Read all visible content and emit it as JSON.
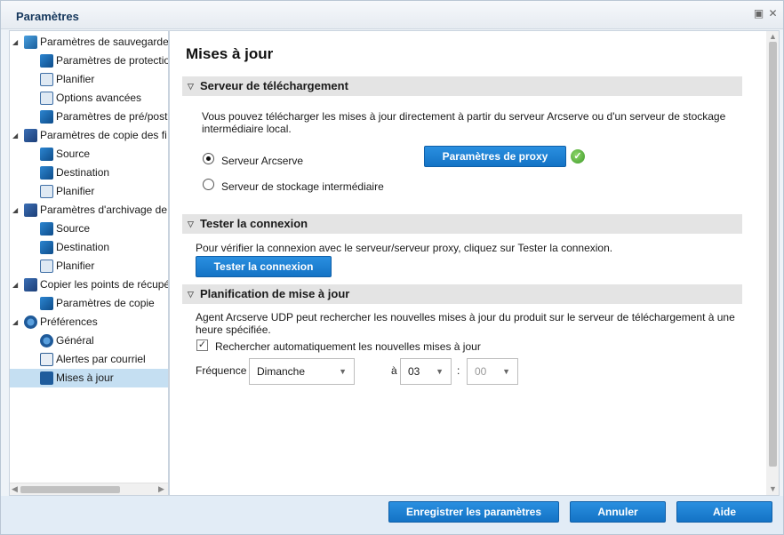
{
  "window": {
    "title": "Paramètres",
    "restore_glyph": "▣",
    "close_glyph": "✕"
  },
  "tree": [
    {
      "label": "Paramètres de sauvegarde",
      "level": 0,
      "icon": "save"
    },
    {
      "label": "Paramètres de protection",
      "level": 1,
      "icon": "leaf-a"
    },
    {
      "label": "Planifier",
      "level": 1,
      "icon": "leaf-b"
    },
    {
      "label": "Options avancées",
      "level": 1,
      "icon": "leaf-b"
    },
    {
      "label": "Paramètres de pré/post",
      "level": 1,
      "icon": "leaf-a"
    },
    {
      "label": "Paramètres de copie des fi",
      "level": 0,
      "icon": "copy"
    },
    {
      "label": "Source",
      "level": 1,
      "icon": "leaf-a"
    },
    {
      "label": "Destination",
      "level": 1,
      "icon": "leaf-a"
    },
    {
      "label": "Planifier",
      "level": 1,
      "icon": "leaf-b"
    },
    {
      "label": "Paramètres d'archivage de",
      "level": 0,
      "icon": "copy"
    },
    {
      "label": "Source",
      "level": 1,
      "icon": "leaf-a"
    },
    {
      "label": "Destination",
      "level": 1,
      "icon": "leaf-a"
    },
    {
      "label": "Planifier",
      "level": 1,
      "icon": "leaf-b"
    },
    {
      "label": "Copier les points de récupé",
      "level": 0,
      "icon": "copy"
    },
    {
      "label": "Paramètres de copie",
      "level": 1,
      "icon": "leaf-a"
    },
    {
      "label": "Préférences",
      "level": 0,
      "icon": "gear"
    },
    {
      "label": "Général",
      "level": 1,
      "icon": "gear"
    },
    {
      "label": "Alertes par courriel",
      "level": 1,
      "icon": "mail"
    },
    {
      "label": "Mises à jour",
      "level": 1,
      "icon": "upd",
      "selected": true
    }
  ],
  "main": {
    "title": "Mises à jour",
    "download_server": {
      "header": "Serveur de téléchargement",
      "description": "Vous pouvez télécharger les mises à jour directement à partir du serveur Arcserve ou d'un serveur de stockage intermédiaire local.",
      "option_arcserve": "Serveur Arcserve",
      "option_staging": "Serveur de stockage intermédiaire",
      "selected": "arcserve",
      "proxy_button": "Paramètres de proxy"
    },
    "test_connection": {
      "header": "Tester la connexion",
      "description": "Pour vérifier la connexion avec le serveur/serveur proxy, cliquez sur Tester la connexion.",
      "button": "Tester la connexion"
    },
    "schedule": {
      "header": "Planification de mise à jour",
      "description": "Agent Arcserve UDP peut rechercher les nouvelles mises à jour du produit sur le serveur de téléchargement à une heure spécifiée.",
      "auto_check_label": "Rechercher automatiquement les nouvelles mises à jour",
      "auto_check": true,
      "frequency_label": "Fréquence",
      "frequency_value": "Dimanche",
      "at_label": "à",
      "hour_value": "03",
      "separator": ":",
      "minute_value": "00"
    }
  },
  "footer": {
    "save": "Enregistrer les paramètres",
    "cancel": "Annuler",
    "help": "Aide"
  }
}
